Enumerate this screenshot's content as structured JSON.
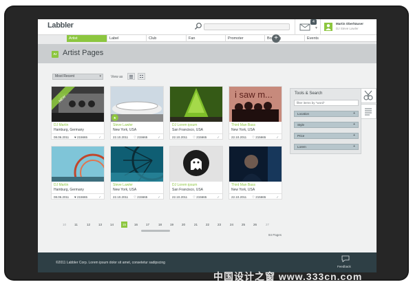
{
  "header": {
    "logo": "Labbler",
    "notification_count": "4",
    "user_name": "Martin Oberhäuser",
    "user_sub": "DJ Steve Lawler"
  },
  "nav": {
    "items": [
      "Artist",
      "Label",
      "Club",
      "Fan",
      "Promoter",
      "Booking",
      "Events"
    ],
    "active": "Artist"
  },
  "page": {
    "badge": "Ar",
    "title": "Artist Pages"
  },
  "toolbar": {
    "sort_value": "Most Recent",
    "view_as_label": "View as"
  },
  "cards": [
    {
      "name": "DJ Martin",
      "location": "Hamburg, Germany",
      "date": "08.06.2011",
      "likes": "215665",
      "ribbon": "NEW"
    },
    {
      "name": "Steve Lawler",
      "location": "New York, USA",
      "date": "22.10.2011",
      "likes": "215665"
    },
    {
      "name": "DJ Lorem ipsum",
      "location": "San Francisco, USA",
      "date": "22.10.2011",
      "likes": "215665"
    },
    {
      "name": "Third Man Bass",
      "location": "New York, USA",
      "date": "22.10.2011",
      "likes": "215665",
      "img_text": "i saw m..."
    },
    {
      "name": "DJ Martin",
      "location": "Hamburg, Germany",
      "date": "08.06.2011",
      "likes": "215665"
    },
    {
      "name": "Steve Lawler",
      "location": "New York, USA",
      "date": "22.10.2011",
      "likes": "215665"
    },
    {
      "name": "DJ Lorem ipsum",
      "location": "San Francisco, USA",
      "date": "22.10.2011",
      "likes": "215665"
    },
    {
      "name": "Third Man Bass",
      "location": "New York, USA",
      "date": "22.10.2011",
      "likes": "215665"
    }
  ],
  "tools": {
    "title": "Tools & Search",
    "filter_placeholder": "filter items by \"word\"",
    "rows": [
      "Location",
      "Style",
      "Price",
      "Lorem"
    ]
  },
  "pagination": {
    "pages": [
      "10",
      "11",
      "12",
      "13",
      "14",
      "15",
      "16",
      "17",
      "18",
      "19",
      "20",
      "21",
      "22",
      "23",
      "24",
      "25",
      "26",
      "27"
    ],
    "current": "15",
    "total_label": "84 Pages"
  },
  "footer": {
    "copyright": "©2011 Labbler Corp. Lorem ipsum dolor sit amet, consetetur sadipscing",
    "feedback": "Feedback"
  },
  "watermark": "中国设计之窗 www.333cn.com",
  "colors": {
    "accent": "#8cc63f",
    "footer": "#2e3f45",
    "frame": "#1b1b1b"
  }
}
